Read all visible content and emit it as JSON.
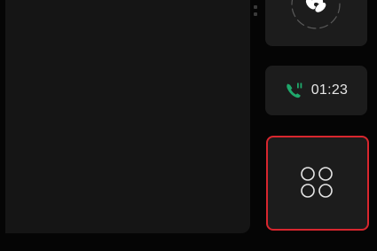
{
  "call": {
    "time": "01:23",
    "icon": "phone-in-call-icon",
    "accent": "#1fa86b"
  },
  "climate": {
    "icon": "fan-icon"
  },
  "apps": {
    "icon": "app-grid-icon",
    "highlight_color": "#d8262e"
  },
  "colors": {
    "background": "#050505",
    "panel": "#151515",
    "tile": "#1c1c1c"
  }
}
